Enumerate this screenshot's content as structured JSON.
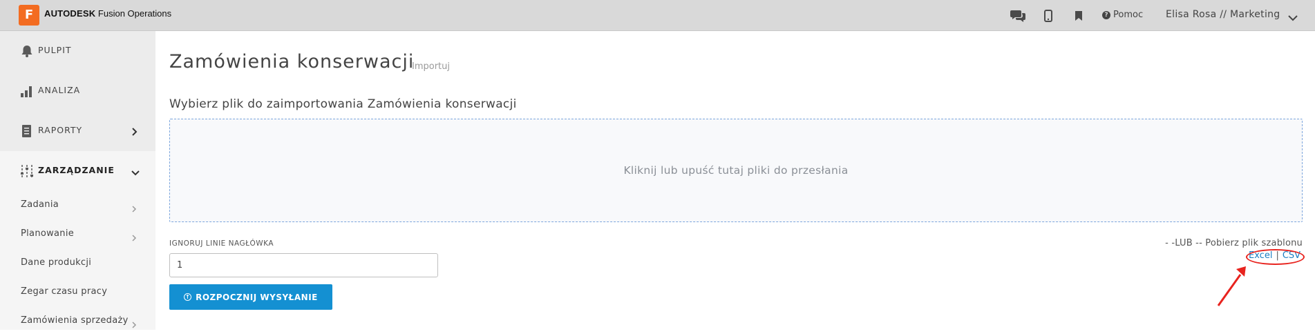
{
  "topbar": {
    "brand_bold": "AUTODESK",
    "brand_rest": " Fusion Operations",
    "logo_letter": "F",
    "help_label": "Pomoc",
    "user_label": "Elisa Rosa // Marketing",
    "icons": [
      "chat-icon",
      "mobile-icon",
      "bookmark-icon",
      "help-icon",
      "chevron-down-icon"
    ]
  },
  "sidebar": {
    "main_items": [
      {
        "label": "PULPIT",
        "icon": "bell-icon"
      },
      {
        "label": "ANALIZA",
        "icon": "bar-chart-icon"
      },
      {
        "label": "RAPORTY",
        "icon": "report-icon"
      },
      {
        "label": "ZARZĄDZANIE",
        "icon": "sliders-icon"
      }
    ],
    "sub_items": [
      {
        "label": "Zadania"
      },
      {
        "label": "Planowanie"
      },
      {
        "label": "Dane produkcji"
      },
      {
        "label": "Zegar czasu pracy"
      },
      {
        "label": "Zamówienia sprzedaży"
      }
    ]
  },
  "main": {
    "title": "Zamówienia konserwacji",
    "breadcrumb": "Importuj",
    "subtitle": "Wybierz plik do zaimportowania Zamówienia konserwacji",
    "dropzone_text": "Kliknij lub upuść tutaj pliki do przesłania",
    "header_lines_label": "IGNORUJ LINIE NAGŁÓWKA",
    "header_lines_value": "1",
    "upload_button": "ROZPOCZNIJ WYSYŁANIE",
    "or_text": "- -LUB -- Pobierz plik szablonu",
    "template_excel": "Excel",
    "template_sep": "|",
    "template_csv": "CSV"
  },
  "colors": {
    "accent": "#1490d2",
    "brand_orange": "#f36c21",
    "annotation_red": "#e8231e"
  }
}
